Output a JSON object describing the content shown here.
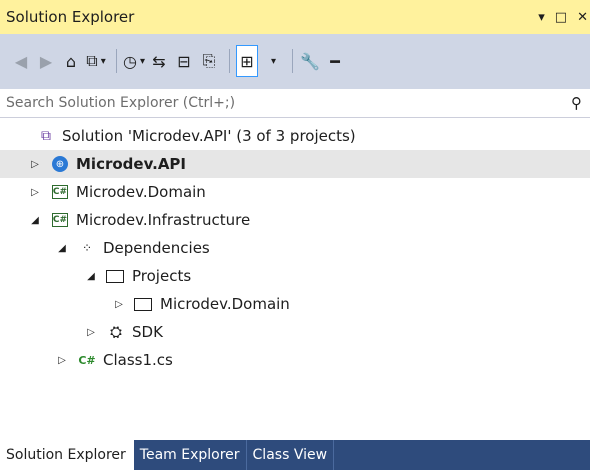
{
  "window": {
    "title": "Solution Explorer",
    "controls": {
      "dropdown": "▾",
      "maximize": "□",
      "close": "✕"
    }
  },
  "toolbar": {
    "buttons": [
      {
        "name": "back-icon",
        "glyph": "◀"
      },
      {
        "name": "forward-icon",
        "glyph": "▶"
      },
      {
        "name": "home-icon",
        "glyph": "⌂"
      },
      {
        "name": "switch-views-icon",
        "glyph": "⧉"
      },
      {
        "name": "pending-changes-filter-icon",
        "glyph": "◷"
      },
      {
        "name": "sync-icon",
        "glyph": "⇆"
      },
      {
        "name": "collapse-all-icon",
        "glyph": "⊟"
      },
      {
        "name": "show-all-files-icon",
        "glyph": "⎘"
      },
      {
        "name": "preview-selected-icon",
        "glyph": "⊞"
      },
      {
        "name": "properties-icon",
        "glyph": "🔧"
      },
      {
        "name": "minus-icon",
        "glyph": "━"
      }
    ]
  },
  "search": {
    "placeholder": "Search Solution Explorer (Ctrl+;)",
    "icon": "search-icon"
  },
  "tree": {
    "solution": "Solution 'Microdev.API' (3 of 3 projects)",
    "items": [
      {
        "label": "Microdev.API",
        "icon": "web-project-icon",
        "expander": "▷",
        "bold": true,
        "selected": true
      },
      {
        "label": "Microdev.Domain",
        "icon": "csharp-project-icon",
        "expander": "▷"
      },
      {
        "label": "Microdev.Infrastructure",
        "icon": "csharp-project-icon",
        "expander": "◢"
      },
      {
        "label": "Dependencies",
        "icon": "dependencies-icon",
        "expander": "◢"
      },
      {
        "label": "Projects",
        "icon": "projects-folder-icon",
        "expander": "◢"
      },
      {
        "label": "Microdev.Domain",
        "icon": "project-reference-icon",
        "expander": "▷"
      },
      {
        "label": "SDK",
        "icon": "sdk-icon",
        "expander": "▷"
      },
      {
        "label": "Class1.cs",
        "icon": "csharp-file-icon",
        "expander": "▷"
      }
    ],
    "badges": {
      "csharp": "C#",
      "csfile": "C#"
    }
  },
  "tabs": [
    {
      "label": "Solution Explorer",
      "active": true
    },
    {
      "label": "Team Explorer",
      "active": false
    },
    {
      "label": "Class View",
      "active": false
    }
  ],
  "colors": {
    "title_bar": "#fff29d",
    "toolbar": "#cfd6e5",
    "selection": "#e6e6e6",
    "tab_bar": "#2e4b7c"
  }
}
